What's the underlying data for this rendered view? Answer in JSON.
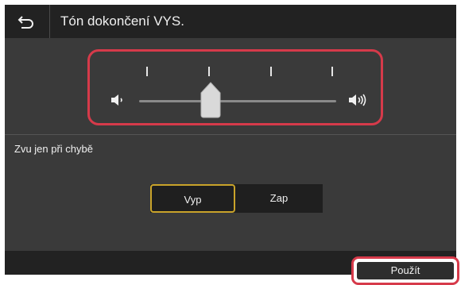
{
  "header": {
    "title": "Tón dokončení VYS.",
    "back_icon": "back-arrow-icon"
  },
  "volume": {
    "level": 2,
    "max": 5,
    "low_icon": "speaker-low-icon",
    "high_icon": "speaker-high-icon"
  },
  "error_only": {
    "label": "Zvu jen při chybě",
    "options": [
      "Vyp",
      "Zap"
    ],
    "selected": "Vyp"
  },
  "footer": {
    "apply_label": "Použít"
  },
  "colors": {
    "highlight": "#d63a4a",
    "selected_outline": "#c9a32a",
    "background": "#3a3a3a"
  }
}
